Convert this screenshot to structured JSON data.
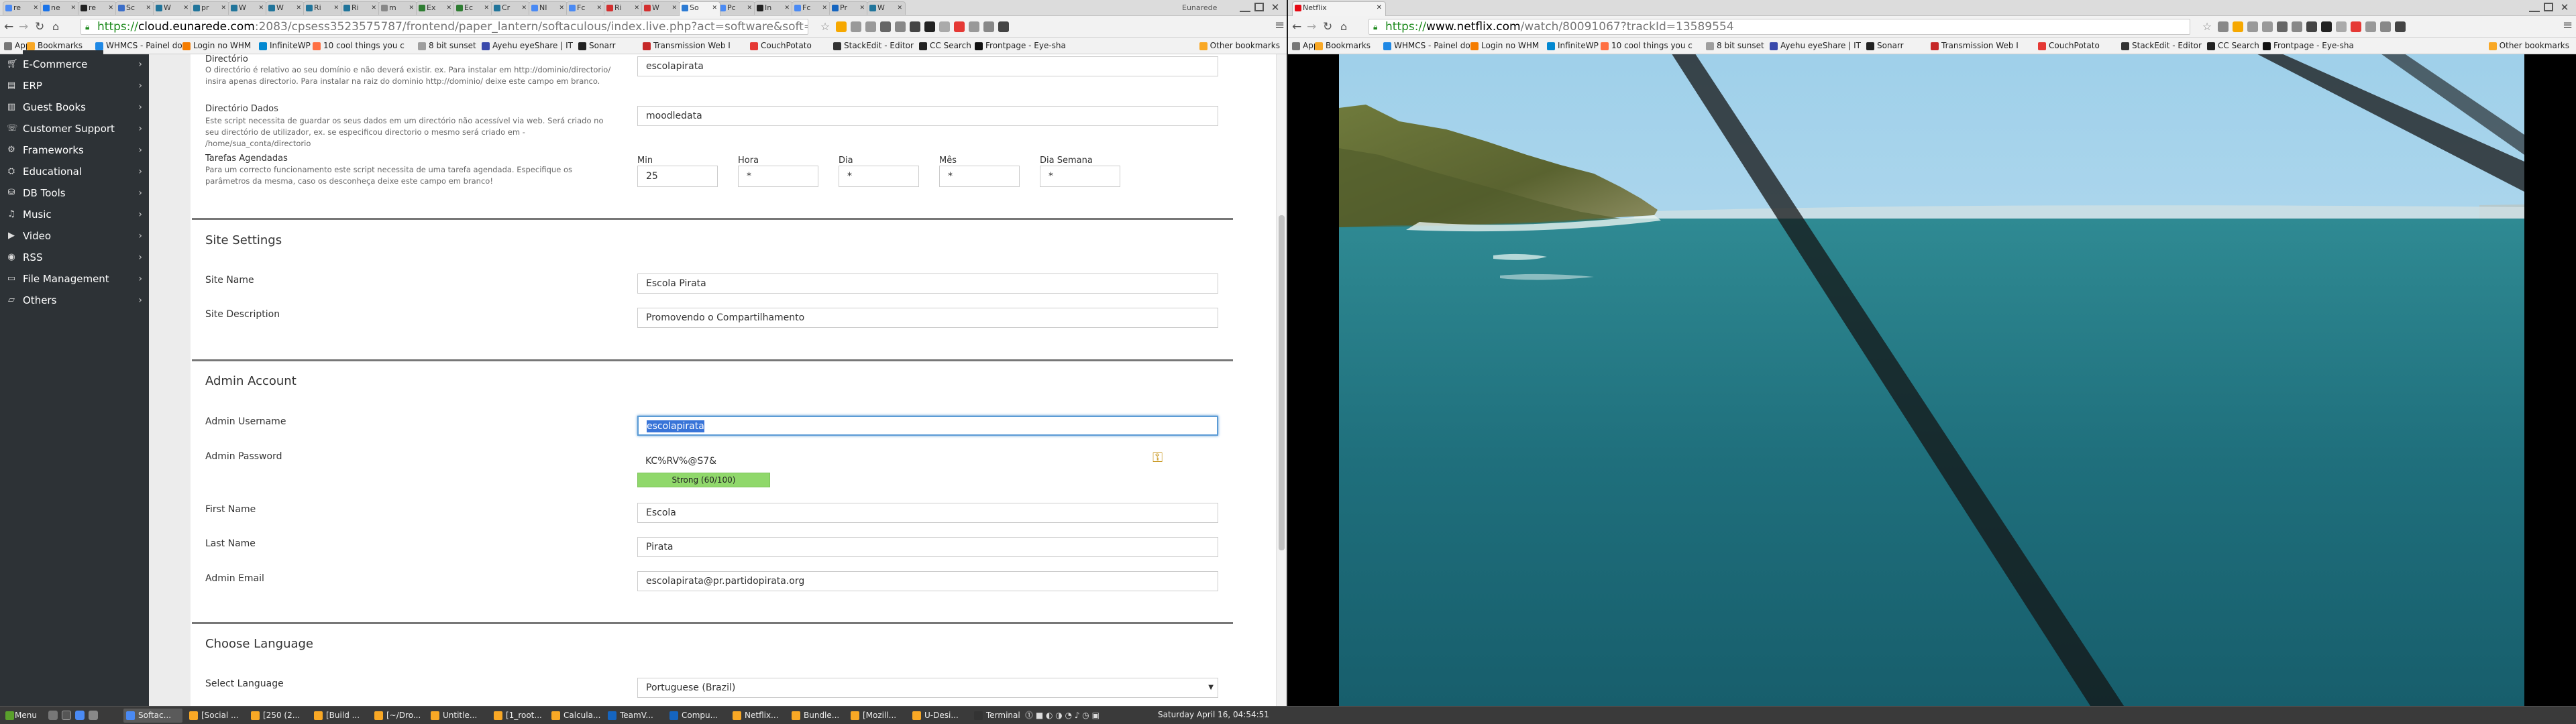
{
  "left_window": {
    "tabs": [
      {
        "label": "re",
        "color": "#4a8af4"
      },
      {
        "label": "ne",
        "color": "#1a73e8"
      },
      {
        "label": "re",
        "color": "#222222"
      },
      {
        "label": "Sc",
        "color": "#3b6ec9"
      },
      {
        "label": "W",
        "color": "#21759b"
      },
      {
        "label": "pr",
        "color": "#21759b"
      },
      {
        "label": "W",
        "color": "#21759b"
      },
      {
        "label": "W",
        "color": "#21759b"
      },
      {
        "label": "Ri",
        "color": "#21759b"
      },
      {
        "label": "Ri",
        "color": "#21759b"
      },
      {
        "label": "m",
        "color": "#888888"
      },
      {
        "label": "Ex",
        "color": "#2e7d32"
      },
      {
        "label": "Ec",
        "color": "#2e7d32"
      },
      {
        "label": "Cr",
        "color": "#21759b"
      },
      {
        "label": "NI",
        "color": "#4a8af4"
      },
      {
        "label": "Fc",
        "color": "#4a8af4"
      },
      {
        "label": "Ri",
        "color": "#d32f2f"
      },
      {
        "label": "W",
        "color": "#d32f2f"
      },
      {
        "label": "So",
        "color": "#2c7bd4"
      },
      {
        "label": "Pc",
        "color": "#4a8af4"
      },
      {
        "label": "In",
        "color": "#222222"
      },
      {
        "label": "Fc",
        "color": "#4a8af4"
      },
      {
        "label": "Pr",
        "color": "#1565c0"
      },
      {
        "label": "W",
        "color": "#21759b"
      }
    ],
    "window_title": "Eunarede",
    "url": {
      "scheme": "https://",
      "host": "cloud.eunarede.com",
      "path": ":2083/cpsess3523575787/frontend/paper_lantern/softaculous/index.live.php?act=software&soft=542"
    },
    "bookmarks": [
      {
        "label": "Apps",
        "color": "#777777"
      },
      {
        "label": "Bookmarks",
        "color": "#f9a825"
      },
      {
        "label": "WHMCS - Painel do",
        "color": "#1e88e5"
      },
      {
        "label": "Login no WHM",
        "color": "#f57c00"
      },
      {
        "label": "InfiniteWP",
        "color": "#0288d1"
      },
      {
        "label": "10 cool things you c",
        "color": "#ff7043"
      },
      {
        "label": "8 bit sunset",
        "color": "#9e9e9e"
      },
      {
        "label": "Ayehu eyeShare | IT",
        "color": "#3949ab"
      },
      {
        "label": "Sonarr",
        "color": "#222222"
      },
      {
        "label": "Transmission Web I",
        "color": "#c62828"
      },
      {
        "label": "CouchPotato",
        "color": "#e53935"
      },
      {
        "label": "StackEdit - Editor",
        "color": "#333333"
      },
      {
        "label": "CC Search",
        "color": "#222222"
      },
      {
        "label": "Frontpage - Eye-sha",
        "color": "#111111"
      },
      {
        "label": "Other bookmarks",
        "color": "#f9a825"
      }
    ],
    "sidebar": [
      {
        "label": "E-Commerce",
        "icon": "cart-icon"
      },
      {
        "label": "ERP",
        "icon": "chart-icon"
      },
      {
        "label": "Guest Books",
        "icon": "book-icon"
      },
      {
        "label": "Customer Support",
        "icon": "support-icon"
      },
      {
        "label": "Frameworks",
        "icon": "frameworks-icon"
      },
      {
        "label": "Educational",
        "icon": "graduation-icon"
      },
      {
        "label": "DB Tools",
        "icon": "database-icon"
      },
      {
        "label": "Music",
        "icon": "music-icon"
      },
      {
        "label": "Video",
        "icon": "video-icon"
      },
      {
        "label": "RSS",
        "icon": "rss-icon"
      },
      {
        "label": "File Management",
        "icon": "folder-icon"
      },
      {
        "label": "Others",
        "icon": "folder-open-icon"
      }
    ],
    "form": {
      "directory_label": "Directório",
      "directory_help": "O directório é relativo ao seu domínio e não deverá existir. ex. Para instalar em http://dominio/directorio/ insira apenas directorio. Para instalar na raiz do dominio http://dominio/ deixe este campo em branco.",
      "directory_value": "escolapirata",
      "data_dir_label": "Directório Dados",
      "data_dir_help": "Este script necessita de guardar os seus dados em um directório não acessível via web. Será criado no seu directório de utilizador, ex. se especificou directorio o mesmo será criado em - /home/sua_conta/directorio",
      "data_dir_value": "moodledata",
      "cron_label": "Tarefas Agendadas",
      "cron_help": "Para um correcto funcionamento este script necessita de uma tarefa agendada. Especifique os parâmetros da mesma, caso os desconheça deixe este campo em branco!",
      "cron": [
        {
          "label": "Min",
          "value": "25"
        },
        {
          "label": "Hora",
          "value": "*"
        },
        {
          "label": "Dia",
          "value": "*"
        },
        {
          "label": "Mês",
          "value": "*"
        },
        {
          "label": "Dia Semana",
          "value": "*"
        }
      ],
      "site_settings_title": "Site Settings",
      "site_name_label": "Site Name",
      "site_name_value": "Escola Pirata",
      "site_desc_label": "Site Description",
      "site_desc_value": "Promovendo o Compartilhamento",
      "admin_title": "Admin Account",
      "admin_user_label": "Admin Username",
      "admin_user_value": "escolapirata",
      "admin_pass_label": "Admin Password",
      "admin_pass_value": "KC%RV%@S7&",
      "strength_text": "Strong (60/100)",
      "strength_percent": 60,
      "first_name_label": "First Name",
      "first_name_value": "Escola",
      "last_name_label": "Last Name",
      "last_name_value": "Pirata",
      "admin_email_label": "Admin Email",
      "admin_email_value": "escolapirata@pr.partidopirata.org",
      "language_title": "Choose Language",
      "language_label": "Select Language",
      "language_value": "Portuguese (Brazil)"
    }
  },
  "right_window": {
    "tab_label": "Netflix",
    "tab_color": "#e50914",
    "url": {
      "scheme": "https://",
      "host": "www.netflix.com",
      "path": "/watch/80091067?trackId=13589554"
    }
  },
  "taskbar": {
    "menu_label": "Menu",
    "items": [
      {
        "label": "Softac...",
        "color": "#4a8af4",
        "active": true
      },
      {
        "label": "[Social ...",
        "color": "#f9a825"
      },
      {
        "label": "[250 (2...",
        "color": "#f9a825"
      },
      {
        "label": "[Build ...",
        "color": "#f9a825"
      },
      {
        "label": "[~/Dro...",
        "color": "#f9a825"
      },
      {
        "label": "Untitle...",
        "color": "#f9a825"
      },
      {
        "label": "[1_root...",
        "color": "#f9a825"
      },
      {
        "label": "Calcula...",
        "color": "#f9a825"
      },
      {
        "label": "TeamV...",
        "color": "#1565c0"
      },
      {
        "label": "Compu...",
        "color": "#1565c0"
      },
      {
        "label": "Netflix...",
        "color": "#f9a825"
      },
      {
        "label": "Bundle...",
        "color": "#f9a825"
      },
      {
        "label": "[Mozill...",
        "color": "#f9a825"
      },
      {
        "label": "U-Desi...",
        "color": "#f9a825"
      },
      {
        "label": "Terminal",
        "color": "#333333"
      }
    ],
    "clock": "Saturday April 16, 04:54:51"
  }
}
